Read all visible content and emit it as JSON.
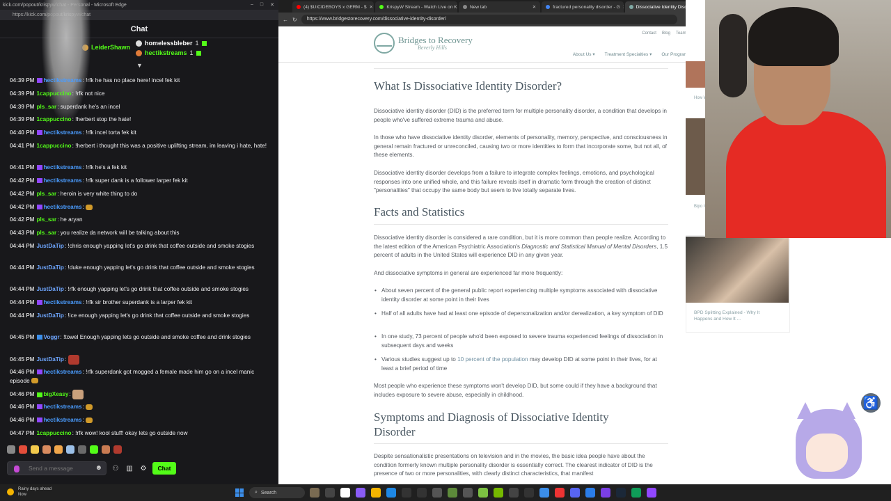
{
  "chat_window": {
    "title": "kick.com/popout/krispyw/chat - Personal - Microsoft Edge",
    "url": "https://kick.com/popout/krispyw/chat",
    "header": "Chat",
    "gifters": [
      {
        "name": "LeiderShawn",
        "count": ""
      },
      {
        "name": "homelessbleber",
        "count": "1"
      },
      {
        "name": "hectikstreams",
        "count": "1"
      }
    ],
    "messages": [
      {
        "time": "04:39 PM",
        "user": "hectikstreams",
        "cls": "u-hectik",
        "text": "!rfk he has no place here! incel fek kit"
      },
      {
        "time": "04:39 PM",
        "user": "1cappuccino",
        "cls": "u-cap",
        "text": "!rfk not nice"
      },
      {
        "time": "04:39 PM",
        "user": "pls_sar",
        "cls": "u-plssar",
        "text": "superdank he's an incel"
      },
      {
        "time": "04:39 PM",
        "user": "1cappuccino",
        "cls": "u-cap",
        "text": "!herbert stop the hate!"
      },
      {
        "time": "04:40 PM",
        "user": "hectikstreams",
        "cls": "u-hectik",
        "text": "!rfk incel torta fek kit"
      },
      {
        "time": "04:41 PM",
        "user": "1cappuccino",
        "cls": "u-cap",
        "text": "!herbert i thought this was a positive uplifting stream, im leaving i hate, hate!"
      },
      {
        "time": "04:41 PM",
        "user": "hectikstreams",
        "cls": "u-hectik",
        "text": "!rfk he's a fek kit"
      },
      {
        "time": "04:42 PM",
        "user": "hectikstreams",
        "cls": "u-hectik",
        "text": "!rfk super dank is a follower larper fek kit"
      },
      {
        "time": "04:42 PM",
        "user": "pls_sar",
        "cls": "u-plssar",
        "text": "heroin is very white thing to do"
      },
      {
        "time": "04:42 PM",
        "user": "hectikstreams",
        "cls": "u-hectik",
        "text": ""
      },
      {
        "time": "04:42 PM",
        "user": "pls_sar",
        "cls": "u-plssar",
        "text": "he aryan"
      },
      {
        "time": "04:43 PM",
        "user": "pls_sar",
        "cls": "u-plssar",
        "text": "you realize da network will be talking about this"
      },
      {
        "time": "04:44 PM",
        "user": "JustDaTip",
        "cls": "u-just",
        "text": "!chris enough yapping let's go drink that coffee outside and smoke stogies"
      },
      {
        "time": "04:44 PM",
        "user": "JustDaTip",
        "cls": "u-just",
        "text": "!duke enough yapping let's go drink that coffee outside and smoke stogies"
      },
      {
        "time": "04:44 PM",
        "user": "JustDaTip",
        "cls": "u-just",
        "text": "!rfk enough yapping let's go drink that coffee outside and smoke stogies"
      },
      {
        "time": "04:44 PM",
        "user": "hectikstreams",
        "cls": "u-hectik",
        "text": "!rfk sir brother superdank is a larper fek kit"
      },
      {
        "time": "04:44 PM",
        "user": "JustDaTip",
        "cls": "u-just",
        "text": "!ice enough yapping let's go drink that coffee outside and smoke stogies"
      },
      {
        "time": "04:45 PM",
        "user": "Voggr",
        "cls": "u-vog",
        "text": "!towel Enough yapping lets go outside and smoke coffee and drink stogies"
      },
      {
        "time": "04:45 PM",
        "user": "JustDaTip",
        "cls": "u-just",
        "text": ""
      },
      {
        "time": "04:46 PM",
        "user": "hectikstreams",
        "cls": "u-hectik",
        "text": "!rfk superdank got mogged a female made him go on a incel manic episode"
      },
      {
        "time": "04:46 PM",
        "user": "bigXeasy",
        "cls": "u-big",
        "text": ""
      },
      {
        "time": "04:46 PM",
        "user": "hectikstreams",
        "cls": "u-hectik",
        "text": ""
      },
      {
        "time": "04:46 PM",
        "user": "hectikstreams",
        "cls": "u-hectik",
        "text": ""
      },
      {
        "time": "04:47 PM",
        "user": "1cappuccino",
        "cls": "u-cap",
        "text": "!rfk wow! kool stuff! okay lets go outside now"
      }
    ],
    "input_placeholder": "Send a message",
    "chat_button": "Chat"
  },
  "browser": {
    "tabs": [
      {
        "label": "(4) $UICIDEBOYS x GERM - $",
        "active": false,
        "color": "#ff0000"
      },
      {
        "label": "KrispyW Stream - Watch Live on K",
        "active": false,
        "color": "#53fc18"
      },
      {
        "label": "New tab",
        "active": false,
        "color": "#888888"
      },
      {
        "label": "fractured personality disorder - G",
        "active": false,
        "color": "#4285f4"
      },
      {
        "label": "Dissociative Identity Disorder - Br",
        "active": true,
        "color": "#7fa8a3"
      }
    ],
    "url": "https://www.bridgestorecovery.com/dissociative-identity-disorder/"
  },
  "site": {
    "logo_title": "Bridges to Recovery",
    "logo_subtitle": "Beverly Hills",
    "top_links": [
      "Contact",
      "Blog",
      "Team"
    ],
    "nav": [
      "About Us",
      "Treatment Specialties",
      "Our Program"
    ],
    "h_what": "What Is Dissociative Identity Disorder?",
    "p1": "Dissociative identity disorder (DID) is the preferred term for multiple personality disorder, a condition that develops in people who've suffered extreme trauma and abuse.",
    "p2": "In those who have dissociative identity disorder, elements of personality, memory, perspective, and consciousness in general remain fractured or unreconciled, causing two or more identities to form that incorporate some, but not all, of these elements.",
    "p3": "Dissociative identity disorder develops from a failure to integrate complex feelings, emotions, and psychological responses into one unified whole, and this failure reveals itself in dramatic form through the creation of distinct \"personalities\" that occupy the same body but seem to live totally separate lives.",
    "h_facts": "Facts and Statistics",
    "p4_pre": "Dissociative identity disorder is considered a rare condition, but it is more common than people realize. According to the latest edition of the American Psychiatric Association's ",
    "p4_em": "Diagnostic and Statistical Manual of Mental Disorders",
    "p4_post": ", 1.5 percent of adults in the United States will experience DID in any given year.",
    "p5": "And dissociative symptoms in general are experienced far more frequently:",
    "bullets": [
      "About seven percent of the general public report experiencing multiple symptoms associated with dissociative identity disorder at some point in their lives",
      "Half of all adults have had at least one episode of depersonalization and/or derealization, a key symptom of DID",
      "In one study, 73 percent of people who'd been exposed to severe trauma experienced feelings of dissociation in subsequent days and weeks"
    ],
    "bullet4_pre": "Various studies suggest up to ",
    "bullet4_link": "10 percent of the population",
    "bullet4_post": " may develop DID at some point in their lives, for at least a brief period of time",
    "p6": "Most people who experience these symptoms won't develop DID, but some could if they have a background that includes exposure to severe abuse, especially in childhood.",
    "h_symptoms": "Symptoms and Diagnosis of Dissociative Identity Disorder",
    "p7": "Despite sensationalistic presentations on television and in the movies, the basic idea people have about the condition formerly known multiple personality disorder is essentially correct. The clearest indicator of DID is the presence of two or more personalities, with clearly distinct characteristics, that manifest"
  },
  "right": {
    "thumb1_caption": "How Whe",
    "thumb2_caption": "Bipo It H",
    "bpd_caption": "BPD Splitting Explained - Why It Happens and How It ..."
  },
  "taskbar": {
    "weather_line1": "Rainy days ahead",
    "weather_line2": "Now",
    "search": "Search"
  }
}
